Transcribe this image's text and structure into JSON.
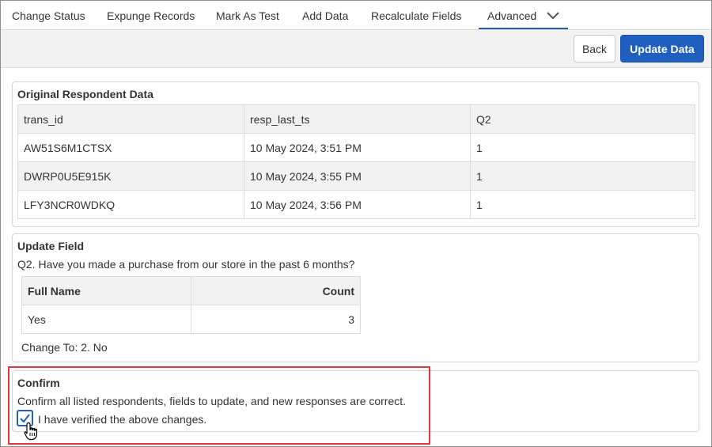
{
  "tabs": [
    {
      "label": "Change Status"
    },
    {
      "label": "Expunge Records"
    },
    {
      "label": "Mark As Test"
    },
    {
      "label": "Add Data"
    },
    {
      "label": "Recalculate Fields"
    },
    {
      "label": "Advanced",
      "active": true
    }
  ],
  "toolbar": {
    "back_label": "Back",
    "update_label": "Update Data"
  },
  "original": {
    "title": "Original Respondent Data",
    "columns": [
      "trans_id",
      "resp_last_ts",
      "Q2"
    ],
    "rows": [
      [
        "AW51S6M1CTSX",
        "10 May 2024, 3:51 PM",
        "1"
      ],
      [
        "DWRP0U5E915K",
        "10 May 2024, 3:55 PM",
        "1"
      ],
      [
        "LFY3NCR0WDKQ",
        "10 May 2024, 3:56 PM",
        "1"
      ]
    ]
  },
  "update": {
    "title": "Update Field",
    "question": "Q2. Have you made a purchase from our store in the past 6 months?",
    "columns": [
      "Full Name",
      "Count"
    ],
    "rows": [
      [
        "Yes",
        "3"
      ]
    ],
    "change_to": "Change To: 2. No"
  },
  "confirm": {
    "title": "Confirm",
    "description": "Confirm all listed respondents, fields to update, and new responses are correct.",
    "checkbox_label": "I have verified the above changes.",
    "checked": true
  },
  "colors": {
    "accent": "#1f5fbf",
    "highlight": "#e0363b",
    "active_tab_underline": "#1f5da8"
  },
  "icons": {
    "tab_dropdown": "chevron-down-icon",
    "checkbox": "check-icon",
    "cursor": "hand-pointer-icon"
  }
}
